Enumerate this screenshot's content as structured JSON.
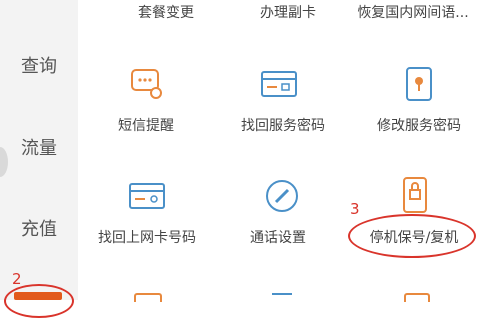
{
  "sidebar": {
    "items": [
      {
        "label": "查询"
      },
      {
        "label": "流量"
      },
      {
        "label": "充值"
      }
    ]
  },
  "services": {
    "row0": [
      "套餐变更",
      "办理副卡",
      "恢复国内网间语..."
    ],
    "row1": [
      "短信提醒",
      "找回服务密码",
      "修改服务密码"
    ],
    "row2": [
      "找回上网卡号码",
      "通话设置",
      "停机保号/复机"
    ]
  },
  "annotations": {
    "num2": "2",
    "num3": "3"
  },
  "colors": {
    "accent": "#d9342b",
    "orange": "#e8893e",
    "blue": "#4a90c8"
  }
}
